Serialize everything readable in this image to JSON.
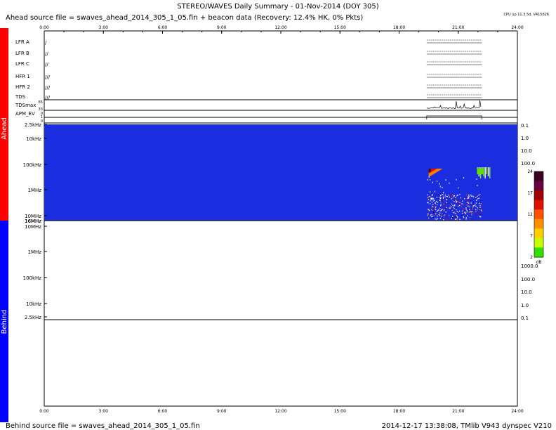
{
  "header": {
    "title": "STEREO/WAVES Daily Summary - 01-Nov-2014 (DOY 305)",
    "ahead_source": "Ahead source file = swaves_ahead_2014_305_1_05.fin + beacon data (Recovery: 12.4% HK,   0% Pkts)",
    "cpu_note": "CPU up 11.3.5d, V415d26"
  },
  "footer": {
    "behind_source": "Behind source file = swaves_ahead_2014_305_1_05.fin",
    "stamp": "2014-12-17 13:38:08, TMlib V943 dynspec V210"
  },
  "side_labels": {
    "ahead": "Ahead",
    "behind": "Behind",
    "ahead_color": "#ff0000",
    "behind_color": "#0000ff"
  },
  "chart_data": {
    "type": "heatmap",
    "time_axis": {
      "ticks": [
        "0:00",
        "3:00",
        "6:00",
        "9:00",
        "12:00",
        "15:00",
        "18:00",
        "21:00",
        "24:00"
      ],
      "range_hours": [
        0,
        24
      ]
    },
    "hk_rows": [
      "LFR A",
      "LFR B",
      "LFR C",
      "HFR 1",
      "HFR 2",
      "TDS",
      "TDSmax",
      "APM_EV"
    ],
    "hk_row_glyphs": [
      "/",
      "//",
      "//",
      "///",
      "///",
      "///",
      "",
      ""
    ],
    "tdsmax_scale": [
      "65",
      "33",
      "0"
    ],
    "apm_scale": [
      "1",
      "0"
    ],
    "ahead_panel": {
      "freq_labels": [
        "2.5kHz",
        "10kHz",
        "100kHz",
        "1MHz",
        "10MHz",
        "16MHz"
      ],
      "right_scale": [
        "0.1",
        "1.0",
        "10.0",
        "100.0"
      ],
      "background_color": "#1a2ee0",
      "data_start_hour": 19.4,
      "data_end_hour": 22.2
    },
    "behind_panel": {
      "freq_labels": [
        "16MHz",
        "10MHz",
        "1MHz",
        "100kHz",
        "10kHz",
        "2.5kHz"
      ],
      "right_scale": [
        "1000.0",
        "100.0",
        "10.0",
        "1.0",
        "0.1"
      ]
    },
    "colorbar": {
      "ticks": [
        "24",
        "17",
        "12",
        "7",
        "2"
      ],
      "unit": "dB",
      "colors": [
        "#3a0024",
        "#6a0040",
        "#a00000",
        "#e01000",
        "#ff5000",
        "#ff9000",
        "#ffd000",
        "#c8ff00",
        "#30e000"
      ]
    }
  }
}
